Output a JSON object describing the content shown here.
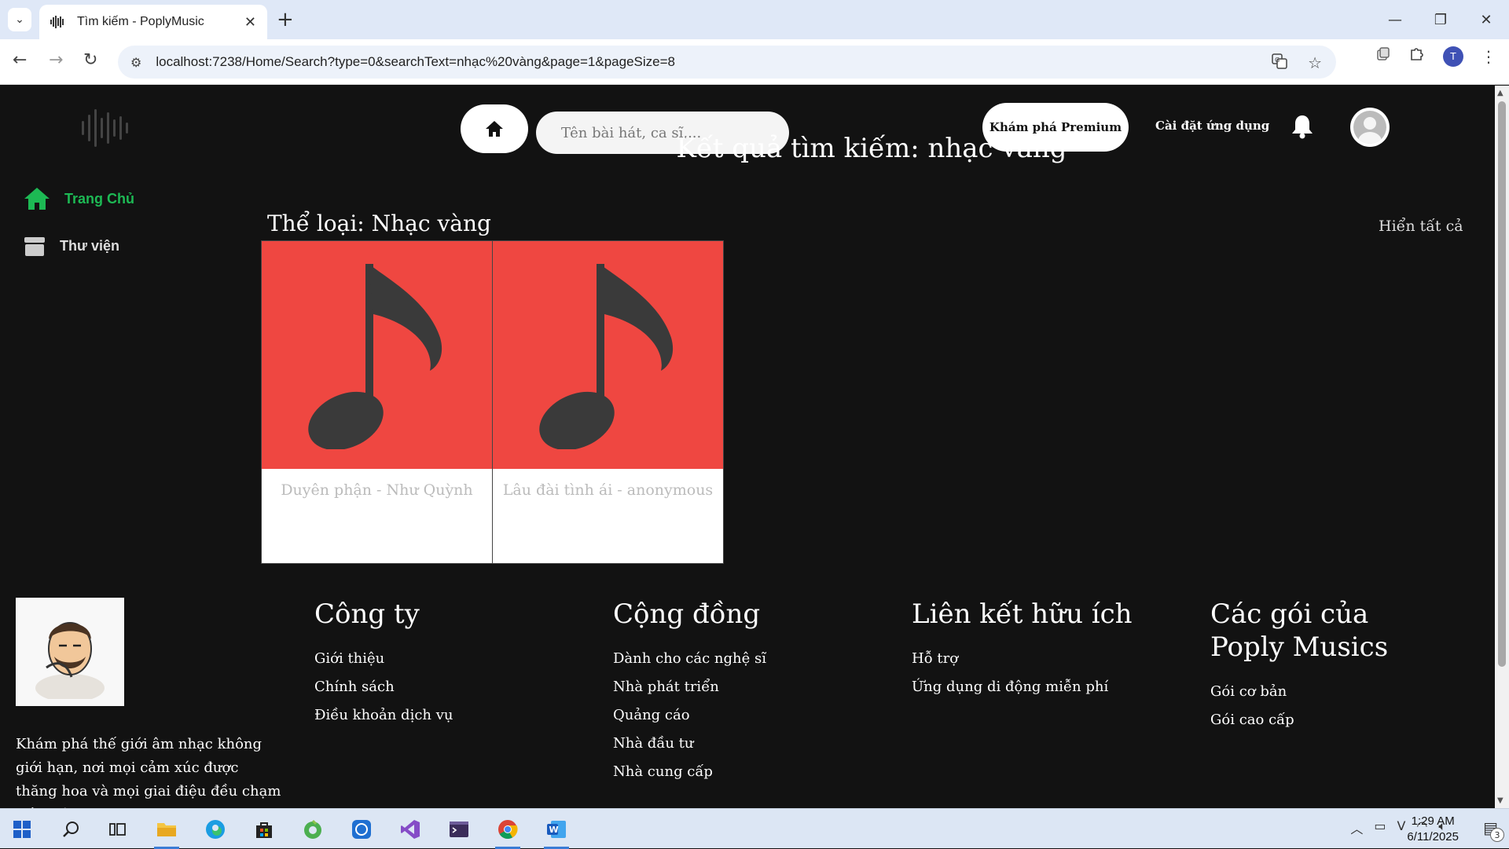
{
  "browser": {
    "tab_title": "Tìm kiếm - PoplyMusic",
    "tab_close": "✕",
    "new_tab": "+",
    "url": "localhost:7238/Home/Search?type=0&searchText=nhạc%20vàng&page=1&pageSize=8",
    "profile_initial": "T"
  },
  "header": {
    "search_placeholder": "Tên bài hát, ca sĩ,...",
    "premium_label": "Khám phá Premium",
    "install_label": "Cài đặt ứng dụng"
  },
  "sidebar": {
    "items": [
      {
        "label": "Trang Chủ",
        "icon": "home-icon",
        "active": true
      },
      {
        "label": "Thư viện",
        "icon": "library-icon",
        "active": false
      }
    ]
  },
  "main": {
    "results_title": "Kết quả tìm kiếm: nhạc vàng",
    "genre_title": "Thể loại: Nhạc vàng",
    "show_all": "Hiển tất cả",
    "songs": [
      {
        "title": "Duyên phận - Như Quỳnh",
        "cover_color": "#ef4741"
      },
      {
        "title": "Lâu đài tình ái - anonymous",
        "cover_color": "#ef4741"
      }
    ]
  },
  "footer": {
    "description": "Khám phá thế giới âm nhạc không giới hạn, nơi mọi cảm xúc được thăng hoa và mọi giai điệu đều chạm đến trái tim.",
    "columns": [
      {
        "title": "Công ty",
        "links": [
          "Giới thiệu",
          "Chính sách",
          "Điều khoản dịch vụ"
        ]
      },
      {
        "title": "Cộng đồng",
        "links": [
          "Dành cho các nghệ sĩ",
          "Nhà phát triển",
          "Quảng cáo",
          "Nhà đầu tư",
          "Nhà cung cấp"
        ]
      },
      {
        "title": "Liên kết hữu ích",
        "links": [
          "Hỗ trợ",
          "Ứng dụng di động miễn phí"
        ]
      },
      {
        "title": "Các gói của Poply Musics",
        "links": [
          "Gói cơ bản",
          "Gói cao cấp"
        ]
      }
    ]
  },
  "taskbar": {
    "time": "1:29 AM",
    "date": "6/11/2025",
    "notification_count": "3"
  },
  "colors": {
    "accent_green": "#1db954",
    "cover_red": "#ef4741",
    "page_bg": "#121212"
  }
}
